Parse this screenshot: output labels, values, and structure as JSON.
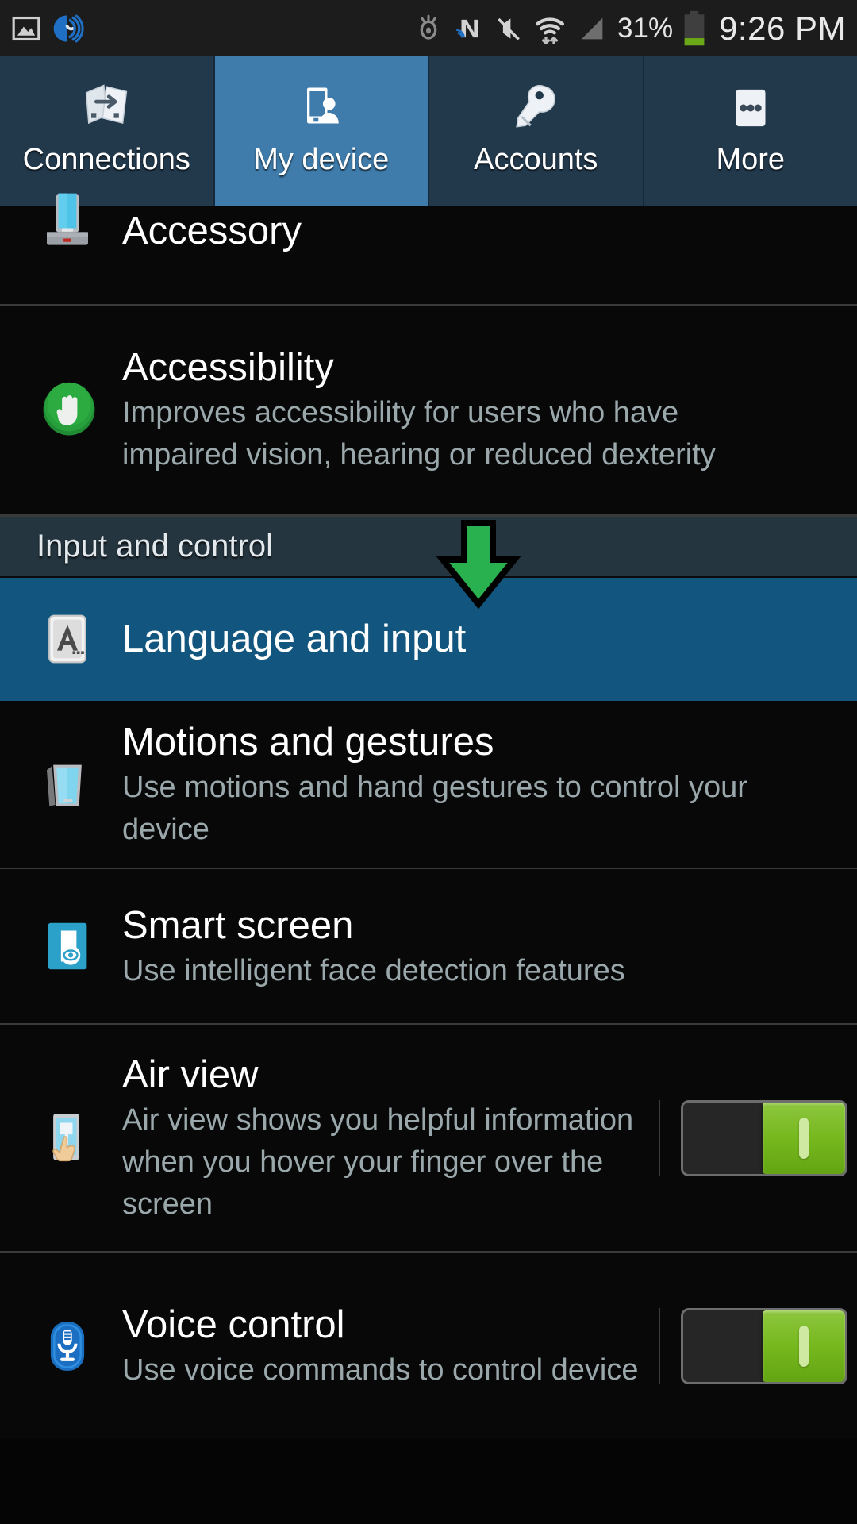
{
  "status_bar": {
    "battery_percent": "31%",
    "clock": "9:26 PM",
    "icons": [
      "image-gallery-icon",
      "smart-stay-blue-icon",
      "eye-smart-stay-icon",
      "nfc-icon",
      "mute-icon",
      "wifi-icon",
      "signal-icon",
      "battery-icon"
    ],
    "colors": {
      "battery_fill": "#6aa818",
      "bar_bg": "#1c1c1c"
    }
  },
  "tabs": [
    {
      "label": "Connections",
      "icon": "connections-icon",
      "active": false
    },
    {
      "label": "My device",
      "icon": "my-device-icon",
      "active": true
    },
    {
      "label": "Accounts",
      "icon": "accounts-key-icon",
      "active": false
    },
    {
      "label": "More",
      "icon": "more-dots-icon",
      "active": false
    }
  ],
  "tab_colors": {
    "inactive": "#22394c",
    "active": "#3f7cab",
    "divider": "#16293a"
  },
  "rows": [
    {
      "title": "Accessory",
      "subtitle": "",
      "icon": "accessory-dock-icon",
      "selected": false,
      "toggle": null
    },
    {
      "title": "Accessibility",
      "subtitle": "Improves accessibility for users who have impaired vision, hearing or reduced dexterity",
      "icon": "accessibility-hand-icon",
      "selected": false,
      "toggle": null
    }
  ],
  "section_header": {
    "label": "Input and control"
  },
  "rows_after": [
    {
      "title": "Language and input",
      "subtitle": "",
      "icon": "language-input-key-icon",
      "selected": true,
      "toggle": null
    },
    {
      "title": "Motions and gestures",
      "subtitle": "Use motions and hand gestures to control your device",
      "icon": "motions-gestures-icon",
      "selected": false,
      "toggle": null
    },
    {
      "title": "Smart screen",
      "subtitle": "Use intelligent face detection features",
      "icon": "smart-screen-icon",
      "selected": false,
      "toggle": null
    },
    {
      "title": "Air view",
      "subtitle": "Air view shows you helpful information when you hover your finger over the screen",
      "icon": "air-view-finger-icon",
      "selected": false,
      "toggle": "on"
    },
    {
      "title": "Voice control",
      "subtitle": "Use voice commands to control device",
      "icon": "voice-control-mic-icon",
      "selected": false,
      "toggle": "on"
    }
  ],
  "annotation": {
    "type": "down-arrow",
    "color": "#2ab14f",
    "points_to": "Language and input"
  },
  "colors": {
    "selected_row": "#12567f",
    "section_header_bg": "#25353f",
    "list_bg": "#080808",
    "divider": "#3a3a3a",
    "title_text": "#ffffff",
    "subtitle_text": "#9aa8ac",
    "toggle_on": "#76b81e"
  }
}
